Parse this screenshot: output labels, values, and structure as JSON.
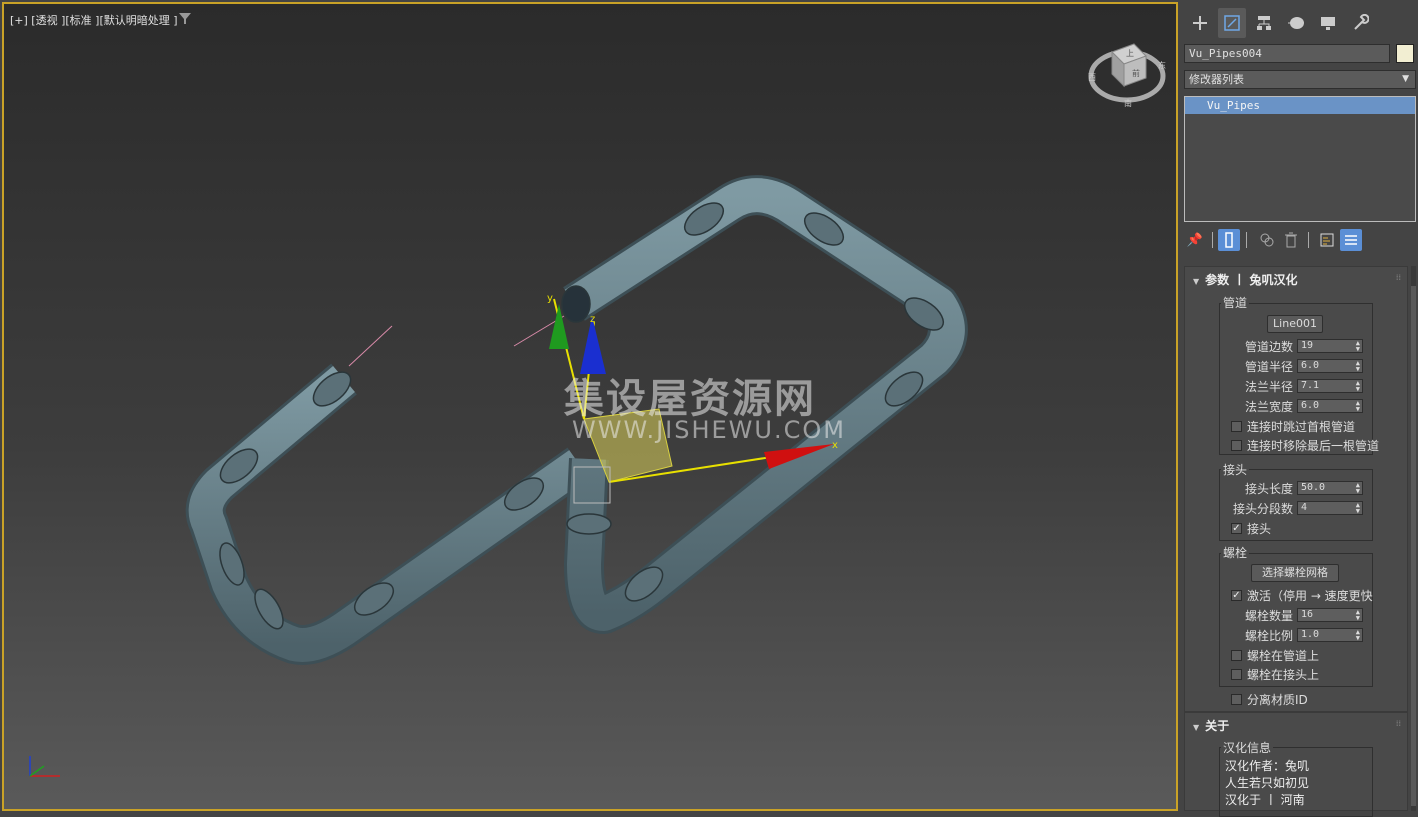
{
  "viewport": {
    "label": "[+] [透视 ][标准 ][默认明暗处理 ]",
    "viewcube_faces": [
      "上",
      "前",
      "东",
      "西",
      "南"
    ],
    "watermark_main": "集设屋资源网",
    "watermark_sub": "WWW.JISHEWU.COM",
    "gizmo_axes": [
      "x",
      "y",
      "z"
    ]
  },
  "panel": {
    "tabs": [
      "create-icon",
      "modify-icon",
      "hierarchy-icon",
      "motion-icon",
      "display-icon",
      "utilities-icon"
    ],
    "object_name": "Vu_Pipes004",
    "object_color": "#f2eed2",
    "modifier_list": "修改器列表",
    "stack_items": [
      "Vu_Pipes"
    ],
    "params": {
      "title": "参数 丨 兔叽汉化",
      "pipe_group": "管道",
      "line_button": "Line001",
      "rows": [
        {
          "label": "管道边数",
          "value": "19"
        },
        {
          "label": "管道半径",
          "value": "6.0"
        },
        {
          "label": "法兰半径",
          "value": "7.1"
        },
        {
          "label": "法兰宽度",
          "value": "6.0"
        }
      ],
      "chk_skip_first": "连接时跳过首根管道",
      "chk_remove_last": "连接时移除最后一根管道",
      "joint_group": "接头",
      "joint_rows": [
        {
          "label": "接头长度",
          "value": "50.0"
        },
        {
          "label": "接头分段数",
          "value": "4"
        }
      ],
      "chk_joint": "接头",
      "bolt_group": "螺栓",
      "bolt_button": "选择螺栓网格",
      "chk_activate": "激活（停用 → 速度更快",
      "bolt_rows": [
        {
          "label": "螺栓数量",
          "value": "16"
        },
        {
          "label": "螺栓比例",
          "value": "1.0"
        }
      ],
      "chk_bolt_pipe": "螺栓在管道上",
      "chk_bolt_joint": "螺栓在接头上",
      "chk_mat_id": "分离材质ID"
    },
    "about": {
      "title": "关于",
      "group": "汉化信息",
      "lines": [
        "汉化作者：兔叽",
        "人生若只如初见",
        "汉化于 丨 河南"
      ]
    }
  }
}
